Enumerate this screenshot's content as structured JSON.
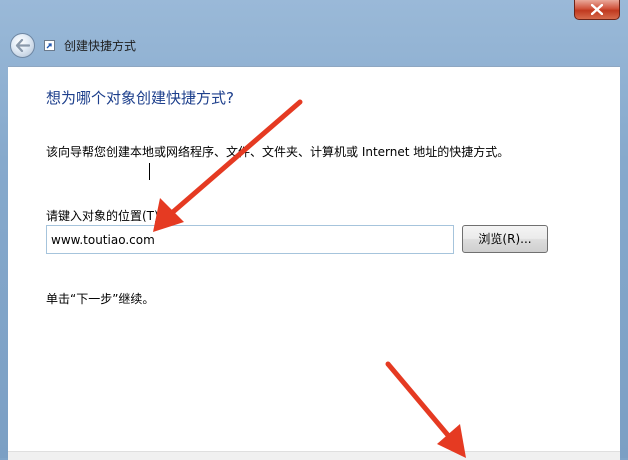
{
  "window": {
    "title": "创建快捷方式"
  },
  "wizard": {
    "heading": "想为哪个对象创建快捷方式?",
    "description": "该向导帮您创建本地或网络程序、文件、文件夹、计算机或 Internet 地址的快捷方式。",
    "location_label": "请键入对象的位置(T):",
    "location_value": "www.toutiao.com",
    "browse_label": "浏览(R)...",
    "hint": "单击“下一步”继续。"
  },
  "icons": {
    "back": "back-arrow-icon",
    "close": "close-icon",
    "shortcut": "shortcut-icon"
  },
  "colors": {
    "heading": "#1d3f8c",
    "annotation_arrow": "#e53a22",
    "close_button": "#c7432a"
  }
}
